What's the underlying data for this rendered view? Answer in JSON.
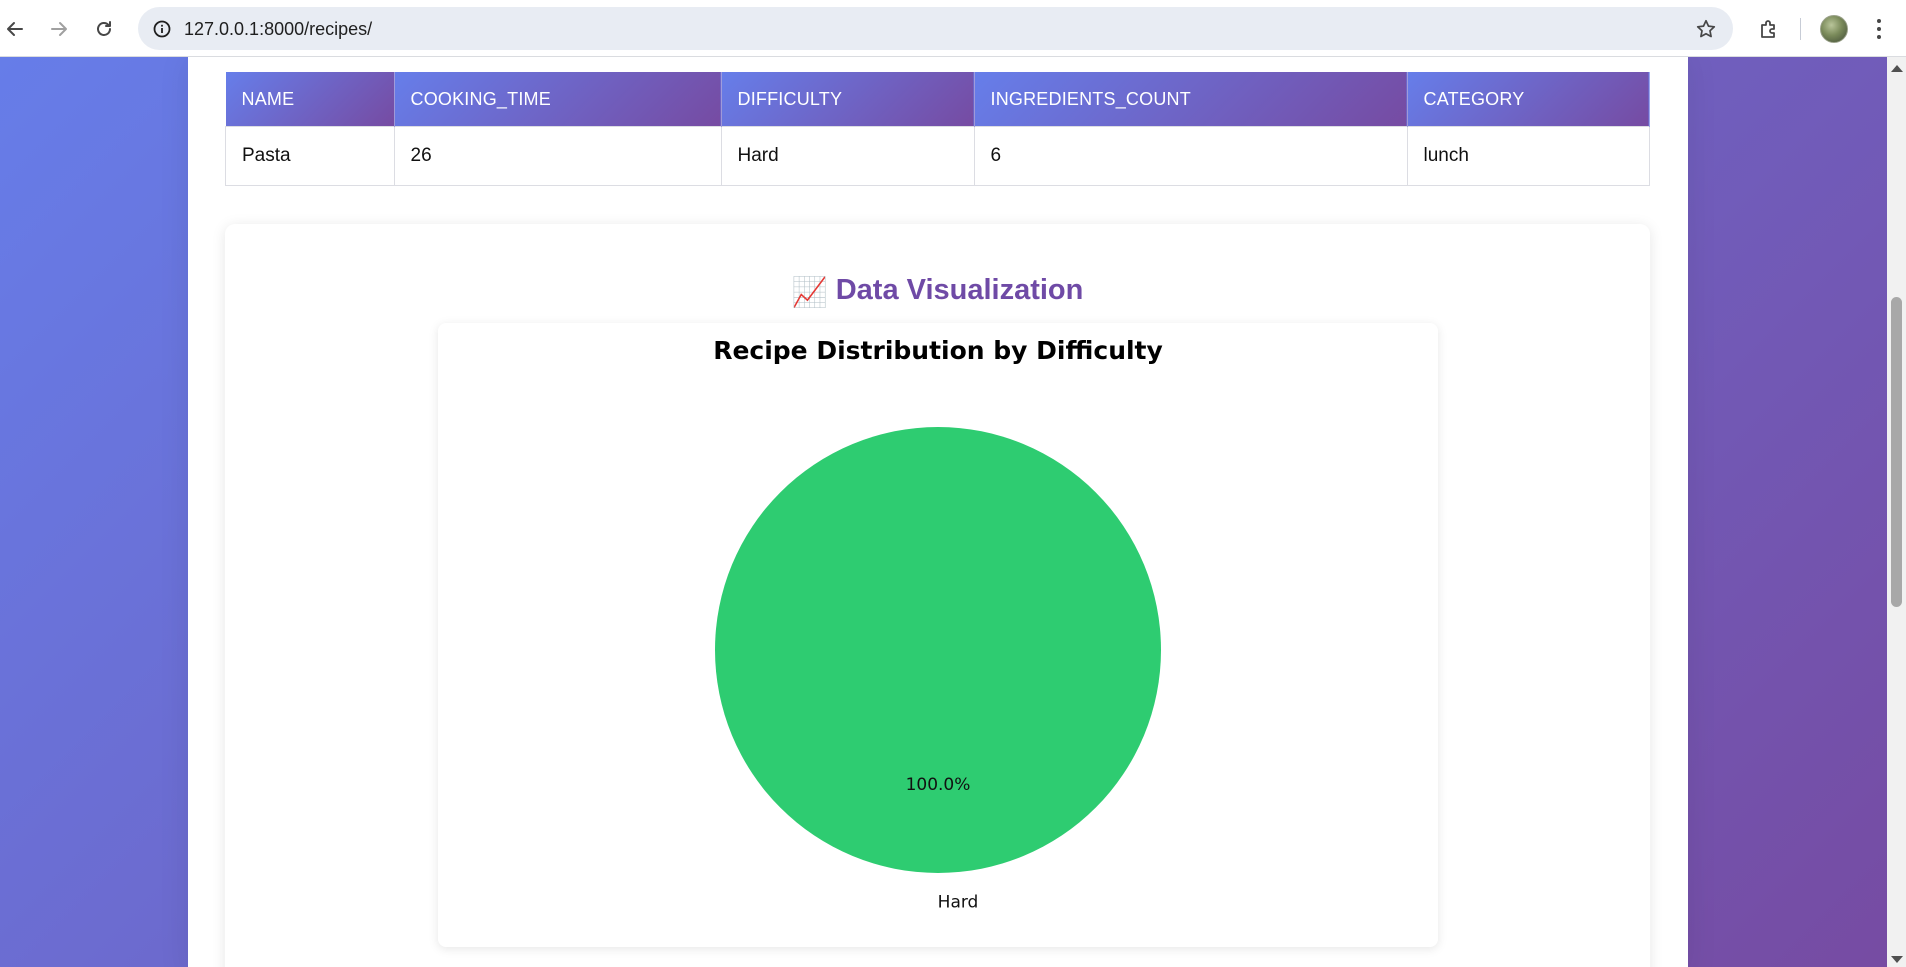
{
  "browser": {
    "url": "127.0.0.1:8000/recipes/",
    "icons": {
      "back": "back-arrow-icon",
      "forward": "forward-arrow-icon",
      "reload": "reload-icon",
      "site_info": "info-icon",
      "bookmark": "star-icon",
      "extensions": "puzzle-icon",
      "menu": "kebab-menu-icon"
    }
  },
  "table": {
    "headers": [
      "NAME",
      "COOKING_TIME",
      "DIFFICULTY",
      "INGREDIENTS_COUNT",
      "CATEGORY"
    ],
    "rows": [
      [
        "Pasta",
        "26",
        "Hard",
        "6",
        "lunch"
      ]
    ]
  },
  "visualization": {
    "heading_emoji": "📈",
    "heading": "Data Visualization"
  },
  "chart_data": {
    "type": "pie",
    "title": "Recipe Distribution by Difficulty",
    "categories": [
      "Hard"
    ],
    "values": [
      1
    ],
    "percent_labels": [
      "100.0%"
    ],
    "colors": [
      "#2ecc71"
    ]
  },
  "colors": {
    "gradient_start": "#667eea",
    "gradient_end": "#764ba2",
    "heading_color": "#6f4aa6"
  }
}
